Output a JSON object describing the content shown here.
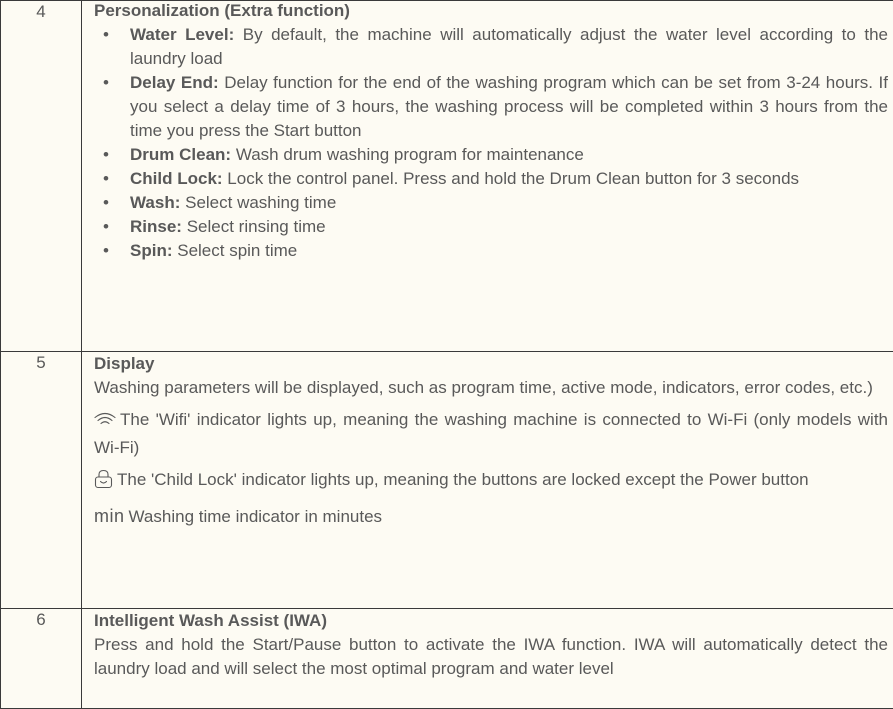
{
  "rows": [
    {
      "number": "4",
      "title": "Personalization (Extra function)",
      "items": [
        {
          "term": "Water Level:",
          "text": "By default, the machine will automatically adjust the water level according to the laundry load"
        },
        {
          "term": "Delay End:",
          "text": "Delay function for the end of the washing program which can be set from 3-24 hours. If you select a delay time of 3 hours, the washing process will be completed within 3 hours from the time you press the Start button"
        },
        {
          "term": "Drum Clean:",
          "text": "Wash drum washing program for maintenance"
        },
        {
          "term": "Child Lock:",
          "text": "Lock the control panel. Press and hold the Drum Clean button for 3 seconds"
        },
        {
          "term": "Wash:",
          "text": "Select washing time"
        },
        {
          "term": "Rinse:",
          "text": "Select rinsing time"
        },
        {
          "term": "Spin:",
          "text": "Select spin time"
        }
      ]
    },
    {
      "number": "5",
      "title": "Display",
      "description": "Washing parameters will be displayed, such as program time, active mode, indicators, error codes, etc.)",
      "indicators": [
        {
          "icon": "wifi-icon",
          "text": "The 'Wifi' indicator lights up, meaning the washing machine is connected to Wi-Fi (only models with Wi-Fi)"
        },
        {
          "icon": "child-lock-icon",
          "text": "The 'Child Lock' indicator lights up, meaning the buttons are locked except the Power button"
        },
        {
          "icon": "min-glyph",
          "symbol": "min",
          "text": "Washing time indicator in minutes"
        }
      ]
    },
    {
      "number": "6",
      "title": "Intelligent Wash Assist (IWA)",
      "description": "Press and hold the Start/Pause button to activate the IWA function. IWA will automatically detect the laundry load and will select the most optimal program and water level"
    }
  ],
  "colors": {
    "text": "#595959",
    "border": "#3a3a3a",
    "background": "#fdfbf3"
  }
}
